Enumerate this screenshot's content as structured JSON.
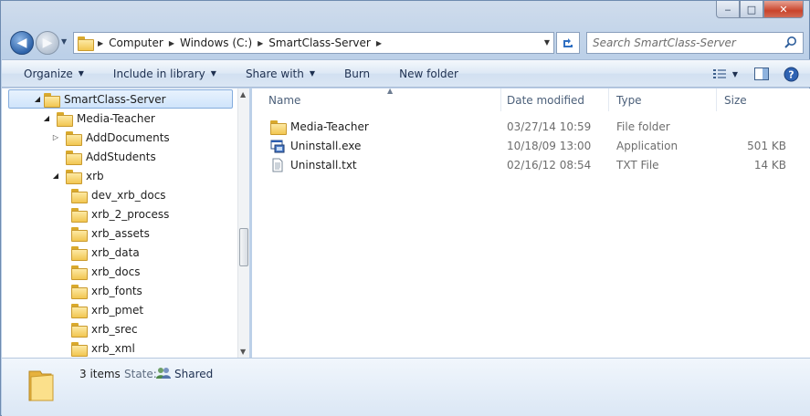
{
  "window": {
    "minimize_label": "‒",
    "maximize_label": "□",
    "close_label": "✕"
  },
  "address": {
    "segments": [
      "Computer",
      "Windows (C:)",
      "SmartClass-Server"
    ],
    "search_placeholder": "Search SmartClass-Server"
  },
  "toolbar": {
    "organize": "Organize",
    "include": "Include in library",
    "share": "Share with",
    "burn": "Burn",
    "new_folder": "New folder"
  },
  "tree": [
    {
      "label": "SmartClass-Server",
      "level": 0,
      "expanded": true,
      "selected": true
    },
    {
      "label": "Media-Teacher",
      "level": 1,
      "expanded": true
    },
    {
      "label": "AddDocuments",
      "level": 2,
      "expanded": false,
      "has_children": true
    },
    {
      "label": "AddStudents",
      "level": 2,
      "expanded": false,
      "has_children": false
    },
    {
      "label": "xrb",
      "level": 2,
      "expanded": true
    },
    {
      "label": "dev_xrb_docs",
      "level": 3
    },
    {
      "label": "xrb_2_process",
      "level": 3
    },
    {
      "label": "xrb_assets",
      "level": 3
    },
    {
      "label": "xrb_data",
      "level": 3
    },
    {
      "label": "xrb_docs",
      "level": 3
    },
    {
      "label": "xrb_fonts",
      "level": 3
    },
    {
      "label": "xrb_pmet",
      "level": 3
    },
    {
      "label": "xrb_srec",
      "level": 3
    },
    {
      "label": "xrb_xml",
      "level": 3
    }
  ],
  "columns": {
    "name": "Name",
    "date": "Date modified",
    "type": "Type",
    "size": "Size"
  },
  "files": [
    {
      "name": "Media-Teacher",
      "date": "03/27/14 10:59",
      "type": "File folder",
      "size": "",
      "icon": "folder-icon"
    },
    {
      "name": "Uninstall.exe",
      "date": "10/18/09 13:00",
      "type": "Application",
      "size": "501 KB",
      "icon": "application-icon"
    },
    {
      "name": "Uninstall.txt",
      "date": "02/16/12 08:54",
      "type": "TXT File",
      "size": "14 KB",
      "icon": "text-file-icon"
    }
  ],
  "details": {
    "count": "3 items",
    "state_label": "State:",
    "state_value": "Shared"
  }
}
